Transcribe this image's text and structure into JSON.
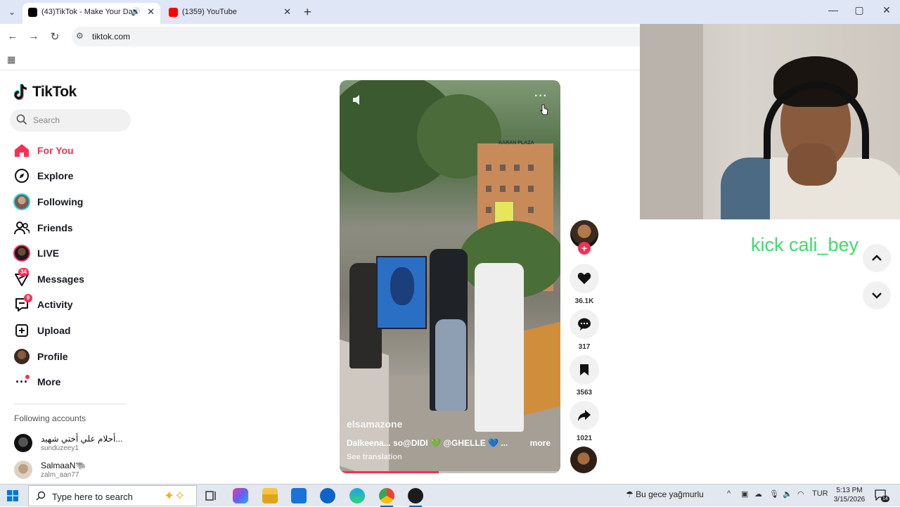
{
  "browser": {
    "tabs": [
      {
        "title": "(43)TikTok - Make Your Day",
        "active": true,
        "favicon_color": "#000000"
      },
      {
        "title": "(1359) YouTube",
        "active": false,
        "favicon_color": "#ff0000"
      }
    ],
    "url": "tiktok.com"
  },
  "sidebar": {
    "logo": "TikTok",
    "search_placeholder": "Search",
    "nav": [
      {
        "label": "For You",
        "icon": "home-icon",
        "active": true
      },
      {
        "label": "Explore",
        "icon": "compass-icon"
      },
      {
        "label": "Following",
        "icon": "following-avatar-icon"
      },
      {
        "label": "Friends",
        "icon": "friends-icon"
      },
      {
        "label": "LIVE",
        "icon": "live-icon"
      },
      {
        "label": "Messages",
        "icon": "paper-plane-icon",
        "badge": "34"
      },
      {
        "label": "Activity",
        "icon": "inbox-icon",
        "badge": "9"
      },
      {
        "label": "Upload",
        "icon": "upload-icon"
      },
      {
        "label": "Profile",
        "icon": "profile-avatar-icon"
      },
      {
        "label": "More",
        "icon": "ellipsis-icon"
      }
    ],
    "following_title": "Following accounts",
    "accounts": [
      {
        "name": "أحلام علي أختي شهيد...",
        "handle": "sunduzeey1"
      },
      {
        "name": "SalmaaN🐃",
        "handle": "zalm_aan77"
      }
    ]
  },
  "video": {
    "author": "elsamazone",
    "caption": "Dalkeena... so@DIDI 💚 @GHELLE 💙 ...",
    "more": "more",
    "translate": "See translation",
    "sign_text": "AARAN PLAZA",
    "progress": 0.45
  },
  "actions": {
    "likes": "36.1K",
    "comments": "317",
    "saves": "3563",
    "shares": "1021"
  },
  "overlay": {
    "kick_text": "kick cali_bey"
  },
  "taskbar": {
    "search_placeholder": "Type here to search",
    "weather": "Bu gece yağmurlu",
    "lang": "TUR",
    "time": "5:13 PM",
    "date": "3/15/2026",
    "notifications": "14"
  },
  "colors": {
    "accent": "#fe2c55",
    "kick_green": "#3ddc6b"
  }
}
